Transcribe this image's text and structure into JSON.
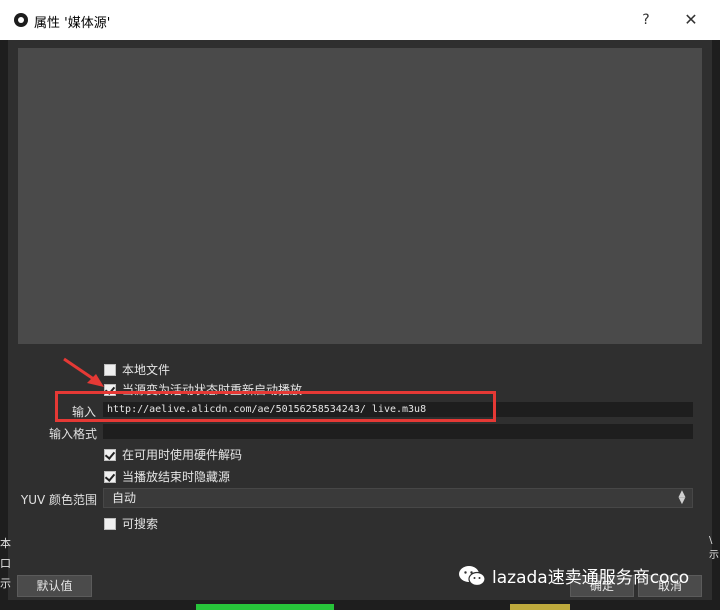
{
  "window": {
    "title": "属性 '媒体源'",
    "help_label": "?",
    "close_label": "✕"
  },
  "options": {
    "local_file": {
      "label": "本地文件",
      "checked": false
    },
    "restart_on_active": {
      "label": "当源变为活动状态时重新启动播放",
      "checked": true
    },
    "hw_decode": {
      "label": "在可用时使用硬件解码",
      "checked": true
    },
    "hide_on_end": {
      "label": "当播放结束时隐藏源",
      "checked": true
    },
    "seekable": {
      "label": "可搜索",
      "checked": false
    }
  },
  "fields": {
    "input_label": "输入",
    "input_value": "http://aelive.alicdn.com/ae/50156258534243/ live.m3u8",
    "input_format_label": "输入格式",
    "input_format_value": "",
    "yuv_label": "YUV 颜色范围",
    "yuv_value": "自动"
  },
  "buttons": {
    "defaults": "默认值",
    "ok": "确定",
    "cancel": "取消"
  },
  "background_text": {
    "edge_1": "本",
    "edge_2": "口",
    "edge_3": "示",
    "right_edge": "\\ 示"
  },
  "watermark": {
    "text": "lazada速卖通服务商coco"
  },
  "colors": {
    "highlight": "#e53935",
    "arrow": "#e53935"
  }
}
